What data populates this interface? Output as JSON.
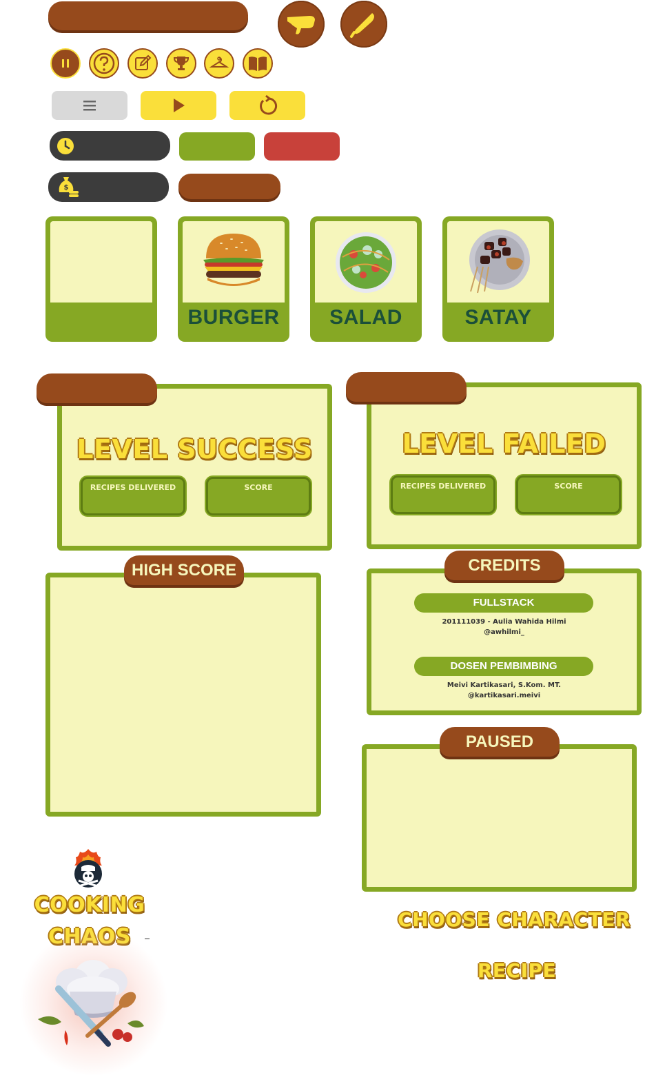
{
  "top_controls": {
    "hand_icon": "hand-grab-icon",
    "knife_icon": "knife-icon"
  },
  "small_buttons": [
    "pause-icon",
    "help-icon",
    "edit-icon",
    "trophy-icon",
    "hanger-icon",
    "book-icon"
  ],
  "control_buttons": {
    "menu_icon": "menu-icon",
    "play_icon": "play-icon",
    "restart_icon": "restart-icon"
  },
  "colors": {
    "brown": "#964a1c",
    "green": "#86a824",
    "cream": "#f6f6bc",
    "yellow": "#fadf3a",
    "red": "#c8413a",
    "dark": "#3c3c3c",
    "gray": "#d9d9d9"
  },
  "recipe_cards": [
    {
      "label": "",
      "image": "empty"
    },
    {
      "label": "BURGER",
      "image": "burger"
    },
    {
      "label": "SALAD",
      "image": "salad"
    },
    {
      "label": "SATAY",
      "image": "satay"
    }
  ],
  "level_success": {
    "title": "LEVEL SUCCESS",
    "recipes_label": "RECIPES DELIVERED",
    "score_label": "SCORE"
  },
  "level_failed": {
    "title": "LEVEL FAILED",
    "recipes_label": "RECIPES DELIVERED",
    "score_label": "SCORE"
  },
  "high_score": {
    "title": "HIGH SCORE"
  },
  "credits": {
    "title": "CREDITS",
    "fullstack_label": "FULLSTACK",
    "fullstack_name": "201111039 - Aulia Wahida Hilmi",
    "fullstack_handle": "@awhilmi_",
    "dosen_label": "DOSEN PEMBIMBING",
    "dosen_name": "Meivi Kartikasari, S.Kom. MT.",
    "dosen_handle": "@kartikasari.meivi"
  },
  "paused": {
    "title": "PAUSED"
  },
  "logo": {
    "line1": "COOKING",
    "line2": "CHAOS"
  },
  "choose_character": "CHOOSE CHARACTER",
  "recipe_title": "RECIPE"
}
